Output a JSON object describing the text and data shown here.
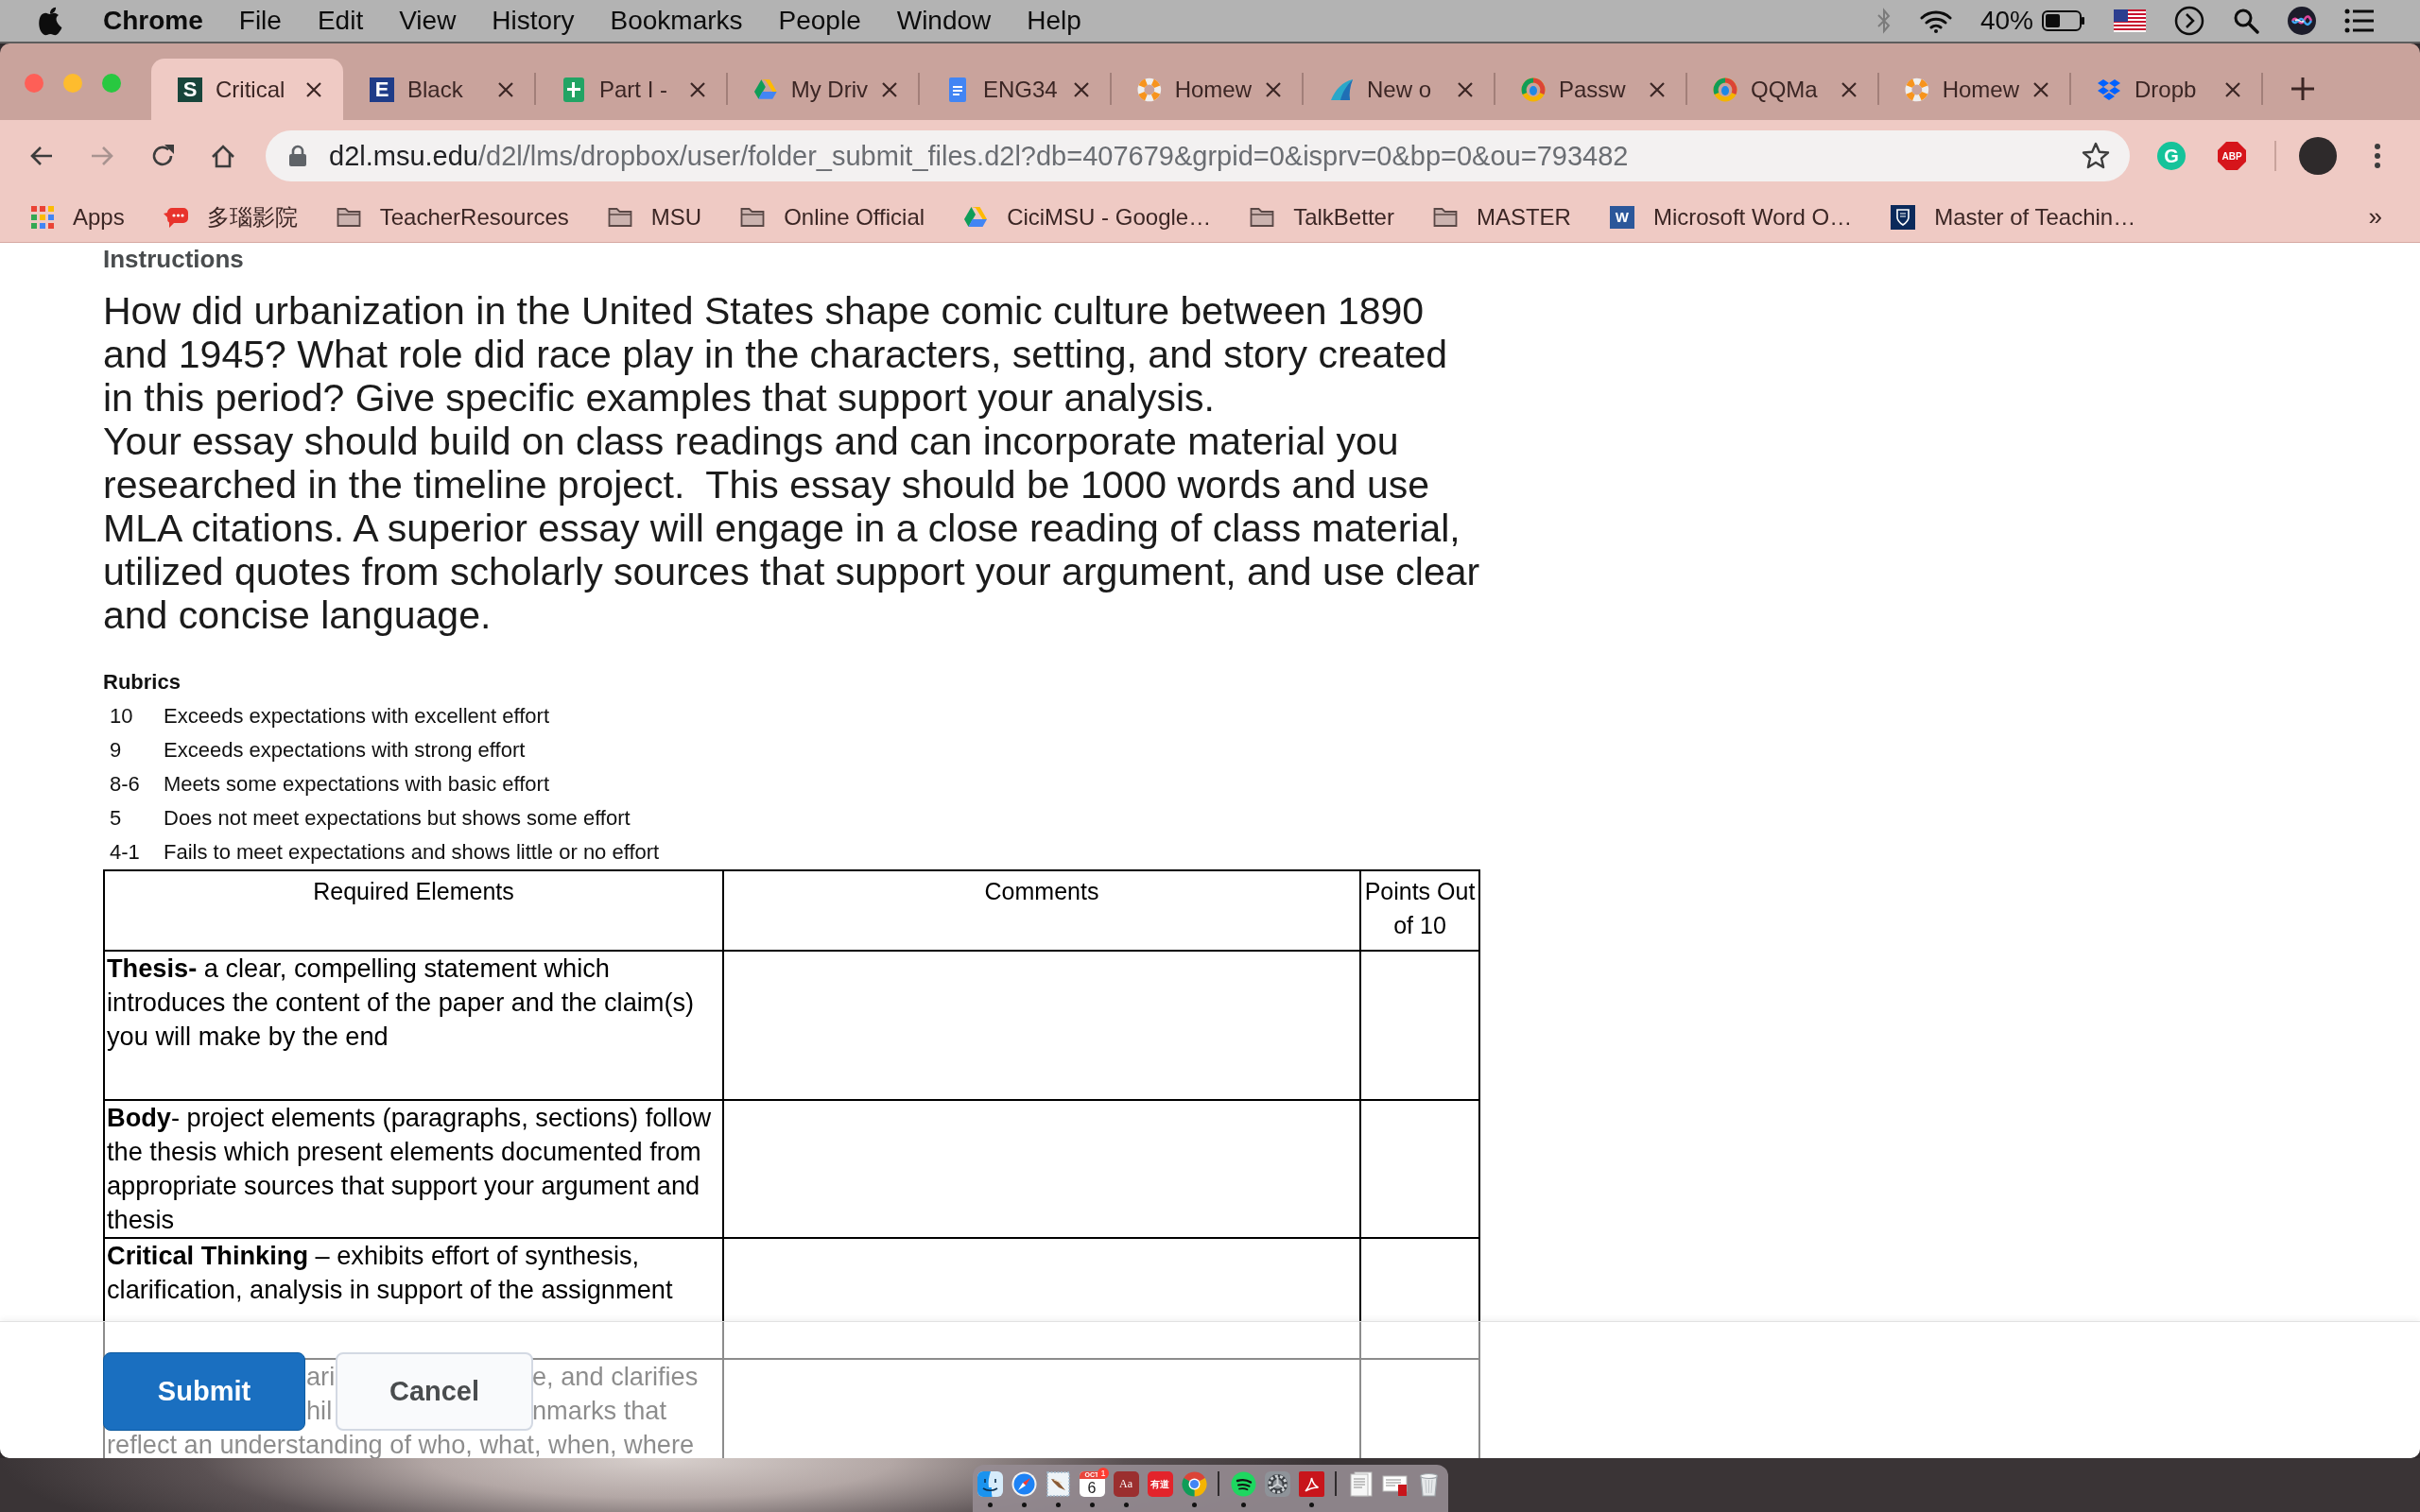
{
  "menu_bar": {
    "app_name": "Chrome",
    "menus": [
      "File",
      "Edit",
      "View",
      "History",
      "Bookmarks",
      "People",
      "Window",
      "Help"
    ],
    "battery_percent": "40%"
  },
  "tabs": [
    {
      "kind": "letter",
      "letter": "S",
      "color": "#18453b",
      "title": "Critical",
      "selected": true
    },
    {
      "kind": "letter",
      "letter": "E",
      "color": "#1f3c88",
      "title": "Black",
      "selected": false
    },
    {
      "kind": "sheets",
      "title": "Part I -",
      "selected": false
    },
    {
      "kind": "drive",
      "title": "My Driv",
      "selected": false
    },
    {
      "kind": "docs",
      "title": "ENG34",
      "selected": false
    },
    {
      "kind": "buoy",
      "title": "Homew",
      "selected": false
    },
    {
      "kind": "fin",
      "title": "New o",
      "selected": false
    },
    {
      "kind": "ring",
      "title": "Passw",
      "selected": false
    },
    {
      "kind": "ring",
      "title": "QQMa",
      "selected": false
    },
    {
      "kind": "buoy",
      "title": "Homew",
      "selected": false
    },
    {
      "kind": "dropbox",
      "title": "Dropb",
      "selected": false
    }
  ],
  "nav_buttons": [
    {
      "kind": "back",
      "disabled": false
    },
    {
      "kind": "forward",
      "disabled": true
    },
    {
      "kind": "reload",
      "disabled": false
    },
    {
      "kind": "home",
      "disabled": false
    }
  ],
  "address_bar": {
    "host": "d2l.msu.edu",
    "path": "/d2l/lms/dropbox/user/folder_submit_files.d2l?db=407679&grpid=0&isprv=0&bp=0&ou=793482"
  },
  "extensions": [
    {
      "kind": "circle",
      "label": "G"
    },
    {
      "kind": "octagon",
      "label": "ABP"
    }
  ],
  "bookmarks": [
    {
      "kind": "apps",
      "label": "Apps"
    },
    {
      "kind": "bubble",
      "label": "多瑙影院"
    },
    {
      "kind": "folder",
      "label": "TeacherResources"
    },
    {
      "kind": "folder",
      "label": "MSU"
    },
    {
      "kind": "folder",
      "label": "Online Official"
    },
    {
      "kind": "drive",
      "label": "CiciMSU - Google…"
    },
    {
      "kind": "folder",
      "label": "TalkBetter"
    },
    {
      "kind": "folder",
      "label": "MASTER"
    },
    {
      "kind": "word",
      "letter": "W",
      "label": "Microsoft Word O…"
    },
    {
      "kind": "crest",
      "label": "Master of Teachin…"
    }
  ],
  "bookmarks_overflow": "»",
  "page": {
    "heading": "Instructions",
    "paragraphs": [
      {
        "lines": [
          "How did urbanization in the United States shape comic culture between 1890",
          "and 1945? What role did race play in the characters, setting, and story created",
          "in this period? Give specific examples that support your analysis."
        ]
      },
      {
        "lines": [
          "Your essay should build on class readings and can incorporate material you",
          "researched in the timeline project.  This essay should be 1000 words and use",
          "MLA citations. A superior essay will engage in a close reading of class material,",
          "utilized quotes from scholarly sources that support your argument, and use clear",
          "and concise language."
        ]
      }
    ],
    "rubric_title": "Rubrics",
    "rubric_levels": [
      {
        "score": "10",
        "description": "Exceeds expectations with excellent effort"
      },
      {
        "score": "9",
        "description": "Exceeds expectations with strong effort"
      },
      {
        "score": "8-6",
        "description": "Meets some expectations with basic effort"
      },
      {
        "score": "5",
        "description": "Does not meet expectations but shows some effort"
      },
      {
        "score": "4-1",
        "description": "Fails to meet expectations and shows little or no effort"
      }
    ],
    "table": {
      "columns": [
        "Required Elements",
        "Comments",
        "Points Out of 10"
      ],
      "rows": [
        {
          "kind": "text",
          "element": "**Thesis-** a clear, compelling statement which introduces the content of the paper and the claim(s) you will make by the end"
        },
        {
          "kind": "text",
          "element": "**Body**- project elements (paragraphs, sections) follow the thesis which present elements documented from appropriate sources that support your argument and thesis"
        },
        {
          "kind": "text",
          "element": "**Critical Thinking** – exhibits effort of synthesis, clarification, analysis in support of the assignment"
        },
        {
          "kind": "covered",
          "lines": [
            [
              "ari",
              "e, and clarifies"
            ],
            [
              "hil",
              "nmarks that"
            ],
            [
              "reflect an understanding of who, what, when, where"
            ]
          ]
        }
      ]
    }
  },
  "footer": {
    "buttons": [
      {
        "kind": "primary",
        "label": "Submit"
      },
      {
        "kind": "secondary",
        "label": "Cancel"
      }
    ]
  },
  "dock": {
    "apps": [
      {
        "kind": "finder",
        "running": true
      },
      {
        "kind": "safari",
        "running": true
      },
      {
        "kind": "mail",
        "running": true
      },
      {
        "kind": "calendar",
        "running": true,
        "month": "OCT",
        "day": "6",
        "badge": "1"
      },
      {
        "kind": "dictionary",
        "running": true,
        "label": "Aa"
      },
      {
        "kind": "youdao",
        "running": false,
        "label": "有道"
      },
      {
        "kind": "chrome",
        "running": true
      }
    ],
    "recent": [
      {
        "kind": "spotify",
        "running": true
      },
      {
        "kind": "settings",
        "running": false
      },
      {
        "kind": "acrobat",
        "running": true
      }
    ],
    "stacks": [
      {
        "kind": "document",
        "running": false
      },
      {
        "kind": "pdf",
        "running": false
      },
      {
        "kind": "trash",
        "running": false
      }
    ]
  }
}
